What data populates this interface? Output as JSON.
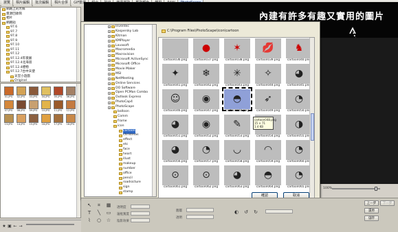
{
  "tabs": [
    "瀏覽",
    "相片編輯",
    "批次編輯",
    "相片合併",
    "GIF動畫",
    "組合",
    "列印",
    "螢幕擷取",
    "截取顏色",
    "轉檔",
    "RAW",
    "PhotoScape"
  ],
  "banner_text": "內建有許多有趣又實用的圖片",
  "left_tree": [
    "網路上的芳鄰",
    "資源回收筒",
    "相片",
    "網路貼",
    "97.6",
    "97.7",
    "97.8",
    "97.9",
    "97.10",
    "97.11",
    "97.12",
    "97.12.4年夜飯",
    "97.12.4北海道",
    "97.12.4禮物",
    "97.12.7台中天使",
    "天堂小遊戲",
    "Original"
  ],
  "thumbs": [
    "01.JPG",
    "02.JPG",
    "03.JPG",
    "04.JPG",
    "05.JPG",
    "06.JPG",
    "07.JPG",
    "08.JPG",
    "09.JPG",
    "10.JPG",
    "11.JPG",
    "12.JPG",
    "13.JPG",
    "14.JPG",
    "15.JPG",
    "16.JPG",
    "17.JPG",
    "18.JPG"
  ],
  "dialog": {
    "path": "C:\\Program Files\\PhotoScape\\icon\\cartoon",
    "tree": [
      "Inventec",
      "Kaspersky Lab",
      "Kitman",
      "KMPlayer",
      "Lavasoft",
      "Macromedia",
      "Macrovision",
      "Microsoft ActiveSync",
      "Microsoft Office",
      "Movie Maker",
      "MSI",
      "NetMeeting",
      "Online Services",
      "OO Software",
      "Open PCMan Combo",
      "Outlook Express",
      "PhotoCap4",
      "PhotoScape",
      "balloon",
      "Comm",
      "frame",
      "icon",
      "cartoon",
      "christmas",
      "effect",
      "etc",
      "face",
      "heart",
      "illust",
      "makeup",
      "number",
      "office",
      "pencil",
      "roadsicture",
      "sign",
      "stamp"
    ],
    "files": [
      "cartoon036.png",
      "cartoon037.png",
      "cartoon038.png",
      "cartoon039.png",
      "cartoon040.png",
      "cartoon041.png",
      "cartoon042.png",
      "cartoon043.png",
      "cartoon044.png",
      "cartoon045.png",
      "cartoon046.png",
      "cartoon047.png",
      "cartoon048.png",
      "cartoon049.png",
      "cartoon050.png",
      "cartoon051.png",
      "cartoon052.png",
      "cartoon053.png",
      "cartoon054.png",
      "cartoon055.png",
      "cartoon056.png",
      "cartoon057.png",
      "cartoon058.png",
      "cartoon059.png",
      "cartoon060.png",
      "cartoon061.png",
      "cartoon062.png",
      "cartoon063.png",
      "cartoon064.png",
      "cartoon065.png"
    ],
    "tooltip": [
      "cartoon048.png",
      "15 × 71",
      "1.4 KB"
    ],
    "ok": "確認",
    "cancel": "取消"
  },
  "bottom": {
    "labels": [
      "透明度",
      "邊框寬度",
      "陰影效果",
      "圖層",
      "透明",
      "過濾",
      "",
      "",
      "",
      "",
      ""
    ],
    "prev": "上一步",
    "next": "下一步",
    "restore": "還原",
    "save": "儲存",
    "zoom": "100%"
  }
}
